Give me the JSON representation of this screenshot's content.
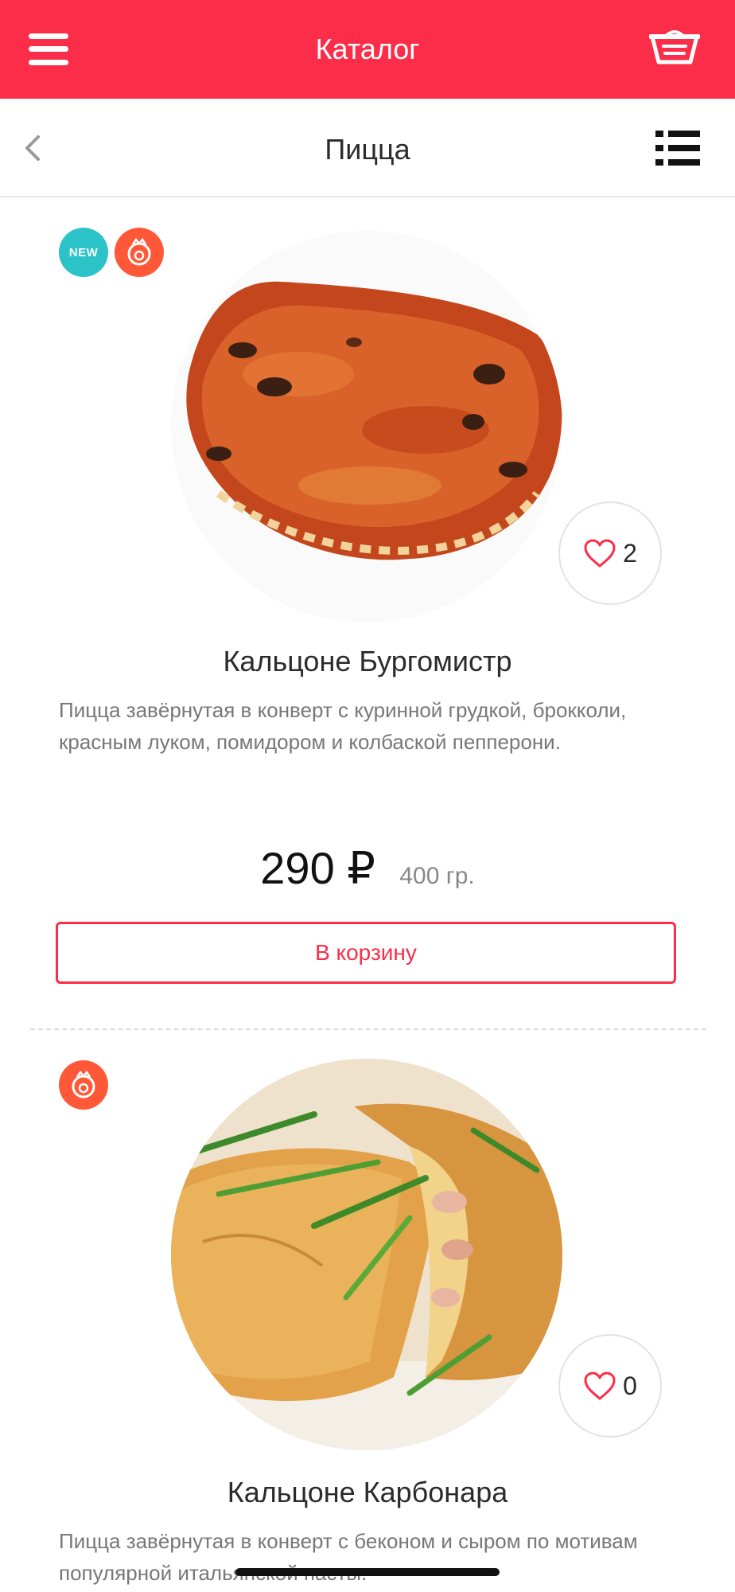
{
  "app_bar": {
    "title": "Каталог",
    "background": "#fb2d48",
    "left_icon": "menu-icon",
    "right_icon": "basket-icon"
  },
  "sub_bar": {
    "title": "Пицца",
    "left_icon": "back-icon",
    "right_icon": "list-view-icon"
  },
  "products": [
    {
      "badges": [
        "NEW",
        "mascot"
      ],
      "title": "Кальцоне Бургомистр",
      "description": "Пицца завёрнутая в конверт с куринной грудкой, брокколи, красным луком, помидором и колбаской пепперони.",
      "price": "290 ₽",
      "weight": "400 гр.",
      "favorites": "2",
      "cart_label": "В корзину"
    },
    {
      "badges": [
        "mascot"
      ],
      "title": "Кальцоне Карбонара",
      "description": "Пицца завёрнутая в конверт с беконом и сыром по мотивам популярной итальянской пасты.",
      "favorites": "0"
    }
  ]
}
